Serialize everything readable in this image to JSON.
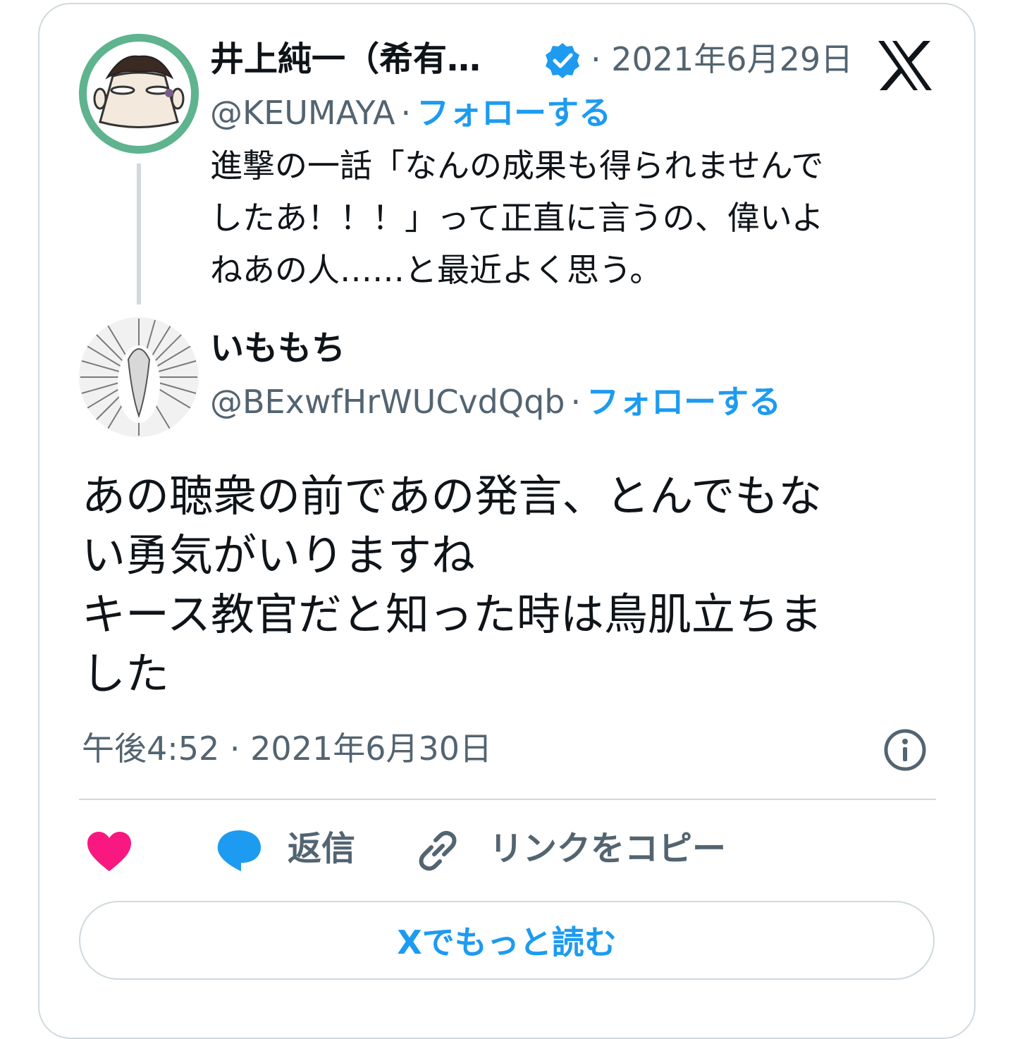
{
  "parent_tweet": {
    "display_name": "井上純一（希有…",
    "handle": "@KEUMAYA",
    "separator": "·",
    "follow_label": "フォローする",
    "date": "· 2021年6月29日",
    "text": "進撃の一話「なんの成果も得られませんで\nしたあ！！！」って正直に言うの、偉いよ\nねあの人……と最近よく思う。",
    "verified_icon": "verified-badge-icon",
    "verified_color": "#1d9bf0",
    "avatar_bg": "#5fb38e"
  },
  "reply_tweet": {
    "display_name": "いももち",
    "handle": "@BExwfHrWUCvdQqb",
    "separator": "·",
    "follow_label": "フォローする",
    "text": "あの聴衆の前であの発言、とんでもな\nい勇気がいりますね\nキース教官だと知った時は鳥肌立ちま\nした",
    "timestamp": "午後4:52 · 2021年6月30日"
  },
  "actions": {
    "like_icon": "heart-icon",
    "like_color": "#f91880",
    "reply_icon": "speech-bubble-icon",
    "reply_color": "#1d9bf0",
    "reply_label": "返信",
    "copy_icon": "link-icon",
    "copy_label": "リンクをコピー",
    "info_icon": "info-icon"
  },
  "read_more_label": "Xでもっと読む",
  "brand_icon": "x-logo-icon",
  "colors": {
    "accent": "#1d9bf0",
    "secondary_text": "#536471",
    "border": "#cfd9de"
  }
}
